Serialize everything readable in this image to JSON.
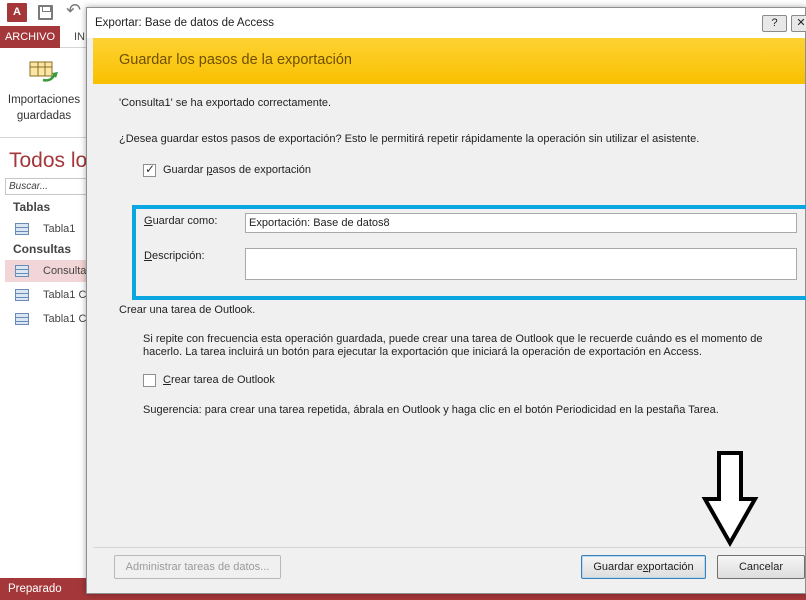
{
  "app": {
    "qat": {
      "access_icon": "A",
      "save_icon": "save-icon",
      "undo_icon": "↶"
    },
    "tabs": {
      "file": "ARCHIVO",
      "home_partial": "IN"
    },
    "ribbon": {
      "saved_imports_line1": "Importaciones",
      "saved_imports_line2": "guardadas"
    },
    "nav": {
      "title": "Todos lo",
      "search_placeholder": "Buscar...",
      "group_tables": "Tablas",
      "table1": "Tabla1",
      "group_queries": "Consultas",
      "query_selected": "Consulta",
      "query_2": "Tabla1 C",
      "query_3": "Tabla1 C"
    },
    "status": "Preparado",
    "accent_color": "#a4373a"
  },
  "dialog": {
    "title": "Exportar: Base de datos de Access",
    "help_label": "?",
    "close_label": "✕",
    "heading": "Guardar los pasos de la exportación",
    "success_msg": "'Consulta1' se ha exportado correctamente.",
    "question": "¿Desea guardar estos pasos de exportación? Esto le permitirá repetir rápidamente la operación sin utilizar el asistente.",
    "save_steps": {
      "pre": "Guardar ",
      "key": "p",
      "post": "asos de exportación",
      "checked": true
    },
    "save_as": {
      "key": "G",
      "rest": "uardar como:",
      "value": "Exportación: Base de datos8"
    },
    "description": {
      "key": "D",
      "rest": "escripción:",
      "value": ""
    },
    "outlook_section_title": "Crear una tarea de Outlook.",
    "outlook_info_1": "Si repite con frecuencia esta operación guardada, puede crear una tarea de Outlook que le recuerde cuándo es el momento de",
    "outlook_info_2": "hacerlo. La tarea incluirá un botón para ejecutar la exportación que iniciará la operación de exportación en Access.",
    "create_task": {
      "key": "C",
      "rest": "rear tarea de Outlook",
      "checked": false
    },
    "tip": "Sugerencia: para crear una tarea repetida, ábrala en Outlook y haga clic en el botón Periodicidad en la pestaña Tarea.",
    "buttons": {
      "manage": "Administrar tareas de datos...",
      "save_pre": "Guardar e",
      "save_key": "x",
      "save_post": "portación",
      "cancel": "Cancelar"
    },
    "highlight_color": "#0aa6e2",
    "header_color": "#fdd233"
  }
}
